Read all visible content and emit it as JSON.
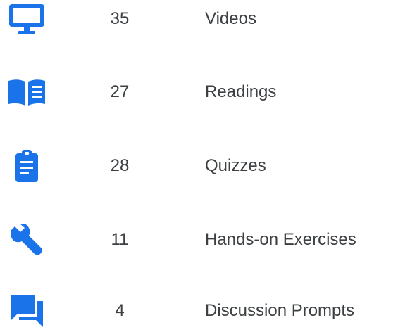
{
  "accent_color": "#1a73e8",
  "items": [
    {
      "count": "35",
      "label": "Videos",
      "icon": "monitor-icon"
    },
    {
      "count": "27",
      "label": "Readings",
      "icon": "book-icon"
    },
    {
      "count": "28",
      "label": "Quizzes",
      "icon": "clipboard-icon"
    },
    {
      "count": "11",
      "label": "Hands-on Exercises",
      "icon": "wrench-icon"
    },
    {
      "count": "4",
      "label": "Discussion Prompts",
      "icon": "chat-icon"
    }
  ]
}
